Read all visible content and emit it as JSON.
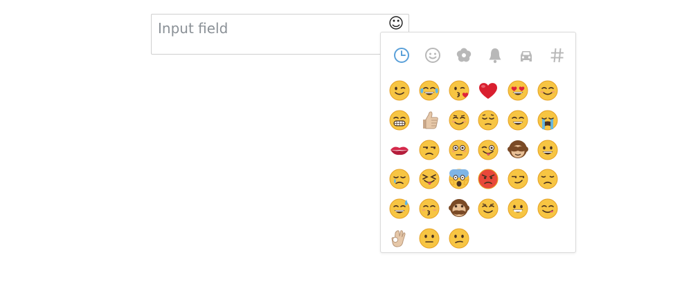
{
  "input": {
    "placeholder": "Input field"
  },
  "trigger": {
    "glyph": "☺",
    "icon": "smiley-icon"
  },
  "picker": {
    "accent_color": "#5aa0d9",
    "tab_inactive_color": "#b8b8b8",
    "tabs": [
      {
        "name": "recent",
        "icon": "clock-icon",
        "active": true
      },
      {
        "name": "people",
        "icon": "smiley-icon",
        "active": false
      },
      {
        "name": "nature",
        "icon": "flower-icon",
        "active": false
      },
      {
        "name": "objects",
        "icon": "bell-icon",
        "active": false
      },
      {
        "name": "places",
        "icon": "car-icon",
        "active": false
      },
      {
        "name": "symbols",
        "icon": "hash-icon",
        "active": false
      }
    ],
    "emojis": [
      "winking-face",
      "face-with-tears-of-joy",
      "face-blowing-a-kiss",
      "red-heart",
      "heart-eyes",
      "smiling-face",
      "grimacing-face",
      "thumbs-up",
      "relieved-face",
      "pensive-face",
      "grinning-face",
      "loudly-crying-face",
      "kiss-mark",
      "unamused-face",
      "flushed-face",
      "winking-tongue-face",
      "see-no-evil-monkey",
      "smiley-face",
      "crying-face",
      "squinting-tongue-face",
      "screaming-in-fear-face",
      "pouting-face",
      "smirking-face",
      "disappointed-face",
      "grinning-sweat-face",
      "kissing-closed-eyes-face",
      "speak-no-evil-monkey",
      "content-face",
      "beaming-face",
      "yum-face",
      "ok-hand",
      "neutral-face",
      "confused-face"
    ]
  }
}
